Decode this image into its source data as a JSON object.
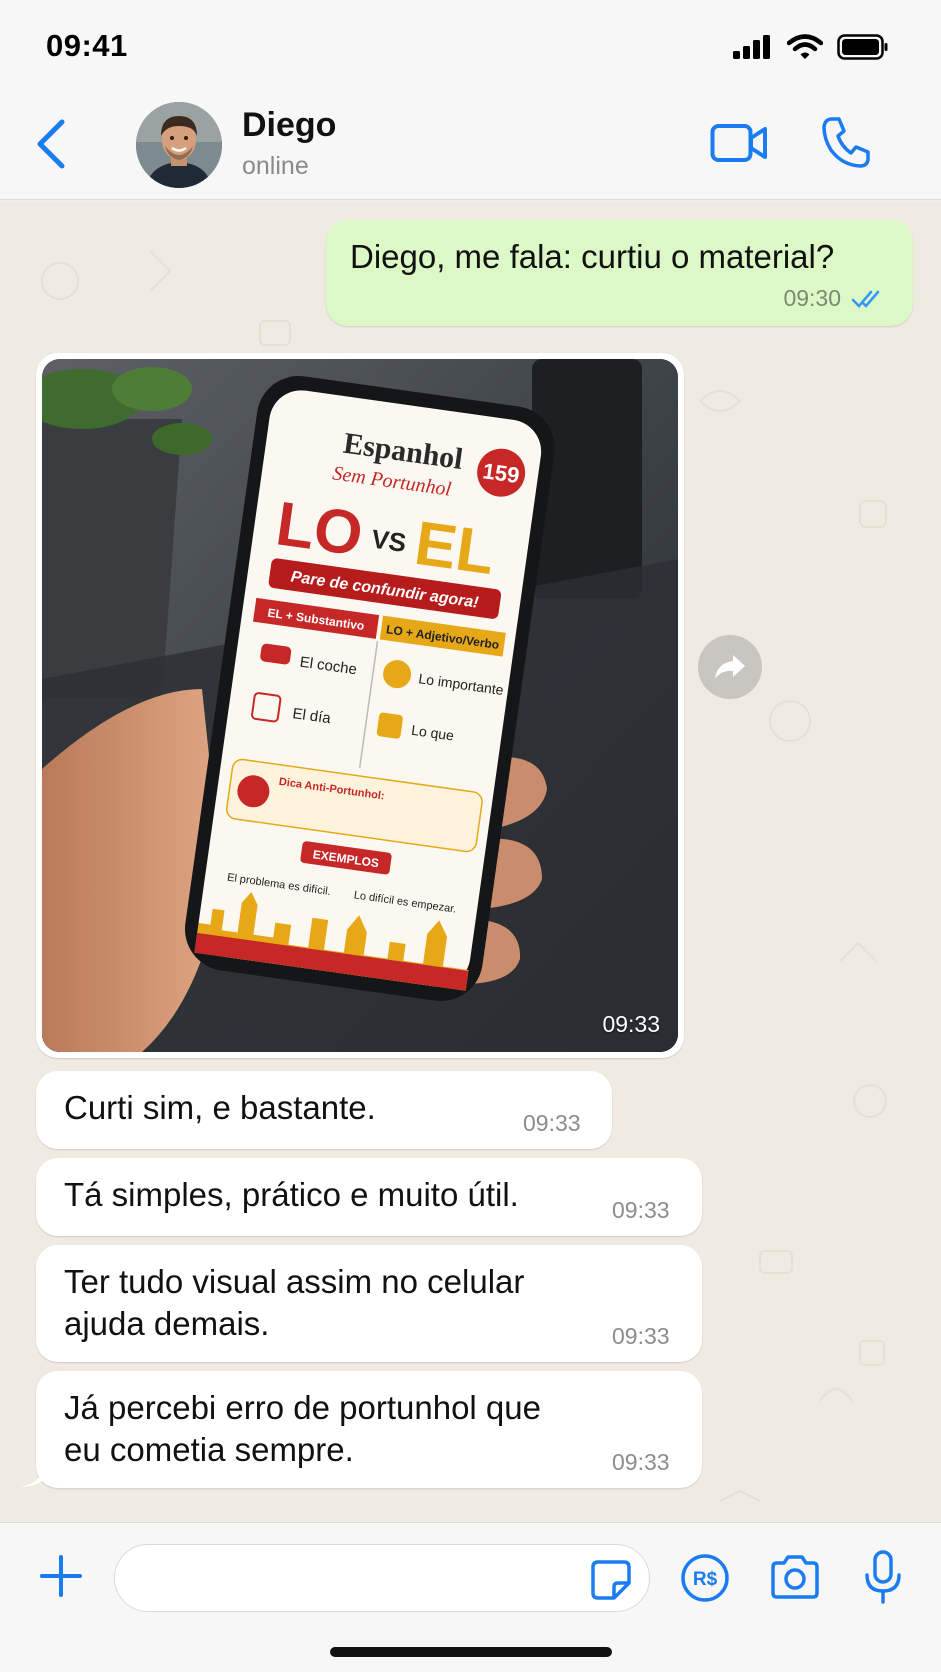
{
  "status_bar": {
    "time": "09:41"
  },
  "header": {
    "contact_name": "Diego",
    "contact_status": "online"
  },
  "messages": {
    "outgoing": {
      "text": "Diego, me fala: curtiu o material?",
      "time": "09:30",
      "status": "read"
    },
    "image": {
      "time": "09:33",
      "poster": {
        "brand": "Espanhol",
        "brand_sub": "Sem Portunhol",
        "number": "159",
        "title_left": "LO",
        "title_vs": "VS",
        "title_right": "EL",
        "banner": "Pare de confundir agora!",
        "col_left": "EL + Substantivo",
        "col_right": "LO + Adjetivo/Verbo",
        "ex_left_1": "El coche",
        "ex_left_2": "El día",
        "ex_right_1": "Lo importante",
        "ex_right_2": "Lo que",
        "tip_title": "Dica Anti-Portunhol:",
        "examples_label": "EXEMPLOS",
        "example_1": "El problema es difícil.",
        "example_2": "Lo difícil es empezar."
      }
    },
    "incoming": [
      {
        "text": "Curti sim, e bastante.",
        "time": "09:33"
      },
      {
        "text": "Tá simples, prático e muito útil.",
        "time": "09:33"
      },
      {
        "text": "Ter tudo visual assim no celular\najuda demais.",
        "time": "09:33"
      },
      {
        "text": "Já percebi erro de portunhol que\neu cometia sempre.",
        "time": "09:33"
      }
    ]
  },
  "input": {
    "value": "",
    "placeholder": ""
  },
  "colors": {
    "accent_blue": "#1a7cf0",
    "outgoing_bubble": "#dcf8c6",
    "incoming_bubble": "#ffffff",
    "chat_background": "#efeae2",
    "read_tick": "#3497f9"
  },
  "icons": {
    "status": [
      "cellular-signal-icon",
      "wifi-icon",
      "battery-icon"
    ],
    "header": [
      "back-chevron-icon",
      "video-camera-icon",
      "phone-icon"
    ],
    "input": [
      "plus-icon",
      "sticker-icon",
      "pix-payment-icon",
      "camera-icon",
      "microphone-icon"
    ],
    "chat": [
      "forward-arrow-icon",
      "double-check-icon"
    ]
  }
}
